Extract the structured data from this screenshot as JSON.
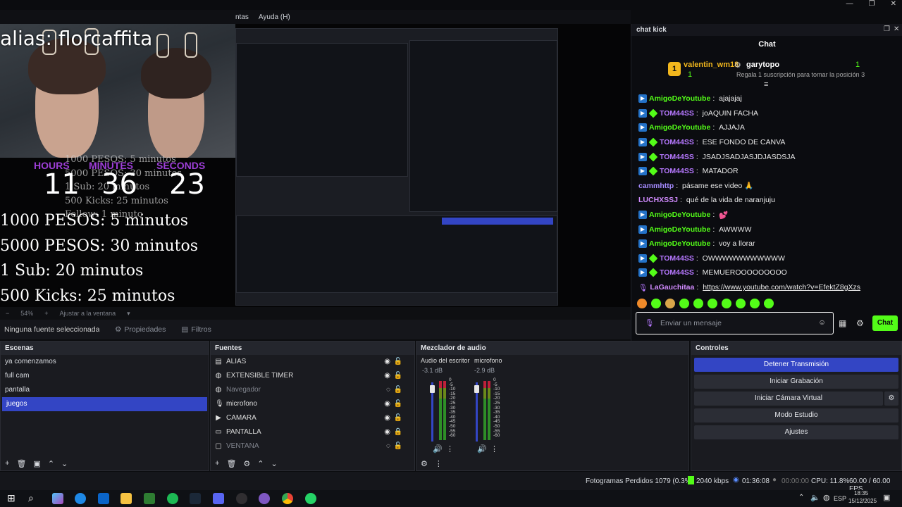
{
  "menubar": {
    "items": [
      "ntas",
      "Ayuda (H)"
    ]
  },
  "preview": {
    "alias": "alias: florcaffita",
    "timer": {
      "hours_label": "HOURS",
      "minutes_label": "MINUTES",
      "seconds_label": "SECONDS",
      "hours": "11",
      "minutes": "36",
      "seconds": "23"
    },
    "rules": [
      "1000 PESOS: 5 minutos",
      "5000 PESOS: 30 minutos",
      "1 Sub: 20 minutos",
      "500 Kicks: 25 minutos",
      "Follow: 1 minuto"
    ],
    "zoom": {
      "percent": "54%",
      "fit": "Ajustar a la ventana"
    }
  },
  "source_bar": {
    "no_source": "Ninguna fuente seleccionada",
    "properties": "Propiedades",
    "filters": "Filtros"
  },
  "chat": {
    "dock_title": "chat kick",
    "header": "Chat",
    "pinned": {
      "user1": "valentin_wm18",
      "rank1": "1",
      "user2": "garytopo",
      "rank2": "1",
      "gift_text": "Regala 1 suscripción para tomar la posición 3"
    },
    "messages": [
      {
        "user": "AmigoDeYoutube",
        "text": "ajajajaj",
        "color": "green",
        "badges": 1
      },
      {
        "user": "TOM44SS",
        "text": "joAQUIN FACHA",
        "color": "purple",
        "badges": 2
      },
      {
        "user": "AmigoDeYoutube",
        "text": "AJJAJA",
        "color": "green",
        "badges": 1
      },
      {
        "user": "TOM44SS",
        "text": "ESE FONDO DE CANVA",
        "color": "purple",
        "badges": 2
      },
      {
        "user": "TOM44SS",
        "text": "JSADJSADJASJDJASDSJA",
        "color": "purple",
        "badges": 2
      },
      {
        "user": "TOM44SS",
        "text": "MATADOR",
        "color": "purple",
        "badges": 2
      },
      {
        "user": "cammhttp",
        "text": "pásame ese video 🙏",
        "color": "violet",
        "badges": 0
      },
      {
        "user": "LUCHXSSJ",
        "text": "qué de la vida de naranjuju",
        "color": "pink",
        "badges": 0
      },
      {
        "user": "AmigoDeYoutube",
        "text": "💕",
        "color": "green",
        "badges": 1
      },
      {
        "user": "AmigoDeYoutube",
        "text": "AWWWW",
        "color": "green",
        "badges": 1
      },
      {
        "user": "AmigoDeYoutube",
        "text": "voy a llorar",
        "color": "green",
        "badges": 1
      },
      {
        "user": "TOM44SS",
        "text": "OWWWWWWWWWWW",
        "color": "purple",
        "badges": 2
      },
      {
        "user": "TOM44SS",
        "text": "MEMUEROOOOOOOOO",
        "color": "purple",
        "badges": 2
      },
      {
        "user": "LaGauchitaa",
        "text": "https://www.youtube.com/watch?v=EfektZ8gXzs",
        "color": "pink",
        "badges": 0,
        "link": true
      }
    ],
    "input_placeholder": "Enviar un mensaje",
    "send_label": "Chat"
  },
  "scenes": {
    "title": "Escenas",
    "items": [
      "ya comenzamos",
      "full cam",
      "pantalla",
      "juegos"
    ],
    "selected": 3
  },
  "sources": {
    "title": "Fuentes",
    "items": [
      {
        "name": "ALIAS",
        "icon": "text-icon",
        "visible": true,
        "locked": false
      },
      {
        "name": "EXTENSIBLE TIMER",
        "icon": "globe-icon",
        "visible": true,
        "locked": false
      },
      {
        "name": "Navegador",
        "icon": "globe-icon",
        "visible": false,
        "locked": false
      },
      {
        "name": "microfono",
        "icon": "mic-icon",
        "visible": true,
        "locked": false
      },
      {
        "name": "CAMARA",
        "icon": "camera-icon",
        "visible": true,
        "locked": false
      },
      {
        "name": "PANTALLA",
        "icon": "monitor-icon",
        "visible": true,
        "locked": true
      },
      {
        "name": "VENTANA",
        "icon": "window-icon",
        "visible": false,
        "locked": false
      }
    ]
  },
  "mixer": {
    "title": "Mezclador de audio",
    "channels": [
      {
        "name": "Audio del escritorio",
        "db": "-3.1 dB"
      },
      {
        "name": "microfono",
        "db": "-2.9 dB"
      }
    ],
    "scale": [
      "0",
      "-5",
      "-10",
      "-15",
      "-20",
      "-25",
      "-30",
      "-35",
      "-40",
      "-45",
      "-50",
      "-55",
      "-60"
    ]
  },
  "controls": {
    "title": "Controles",
    "buttons": [
      "Detener Transmisión",
      "Iniciar Grabación",
      "Iniciar Cámara Virtual",
      "Modo Estudio",
      "Ajustes"
    ]
  },
  "status": {
    "dropped": "Fotogramas Perdidos 1079 (0.3%)",
    "bitrate": "2040 kbps",
    "live_time": "01:36:08",
    "rec_time": "00:00:00",
    "cpu": "CPU: 11.8%",
    "fps": "60.00 / 60.00 FPS"
  },
  "taskbar": {
    "lang": "ESP",
    "time": "18:35",
    "date": "15/12/2025"
  },
  "colors": {
    "accent": "#3345c4",
    "kick_green": "#53fc18",
    "bg": "#1a1b20"
  }
}
